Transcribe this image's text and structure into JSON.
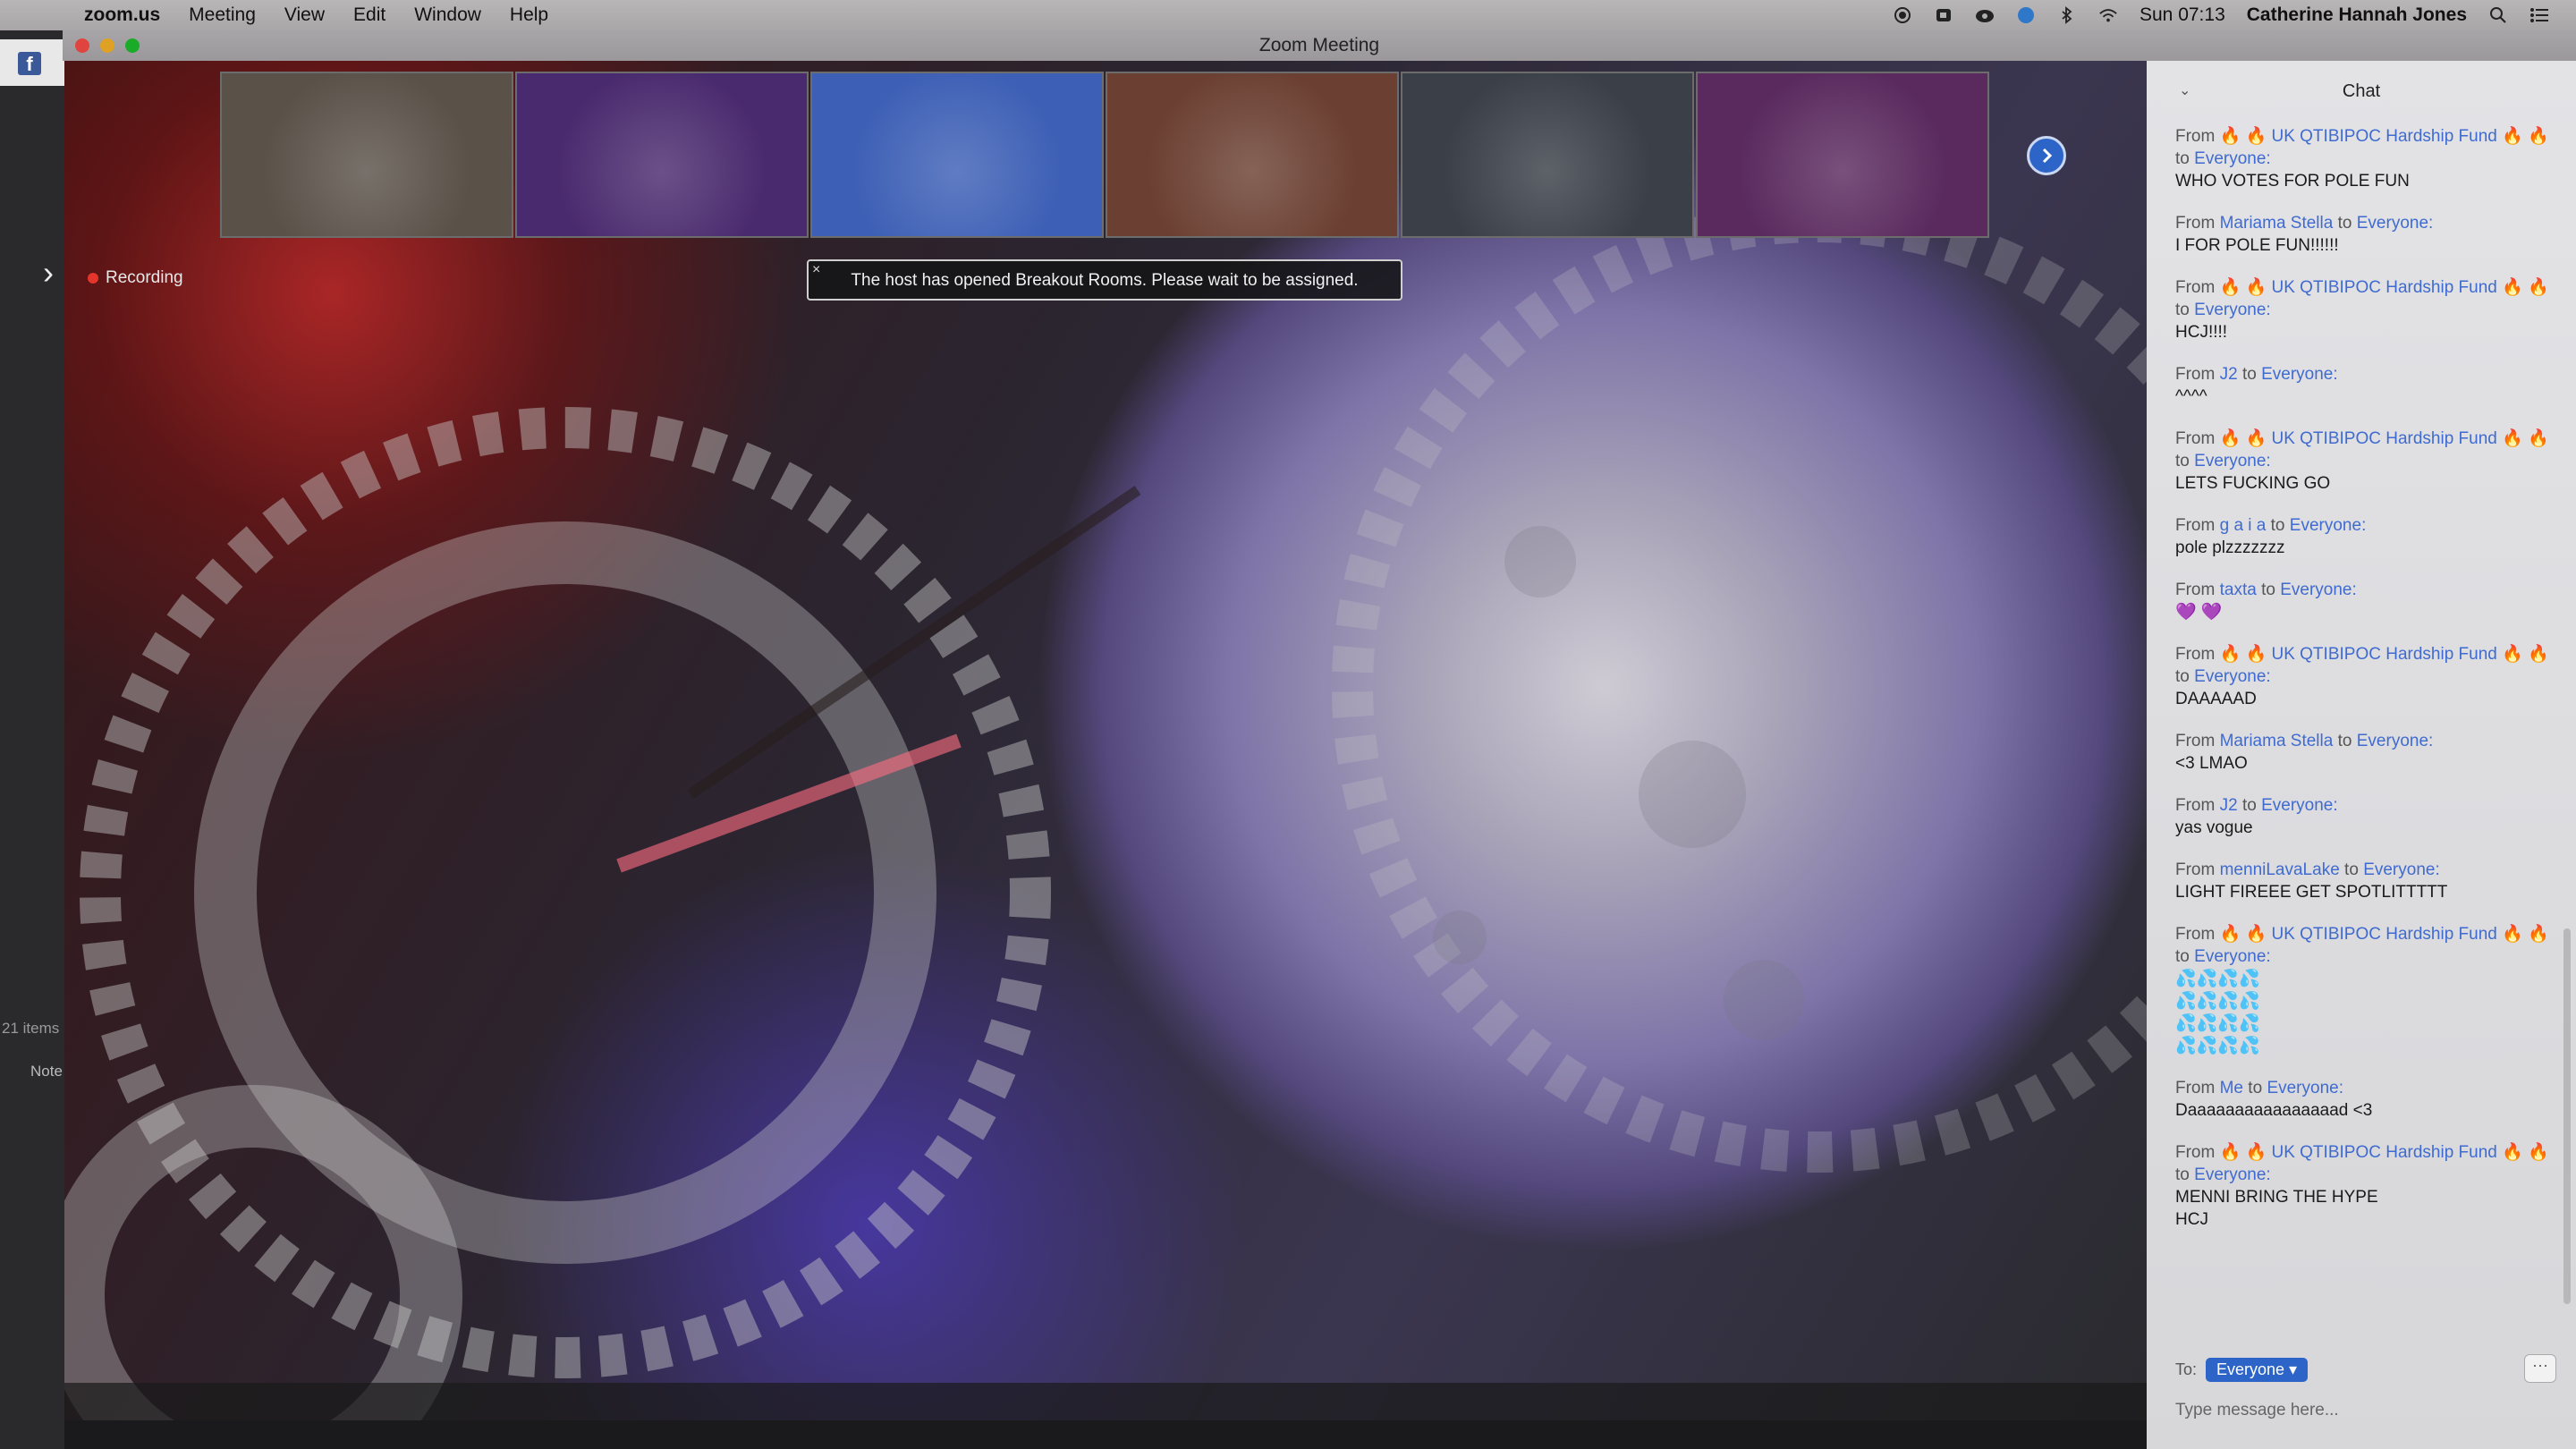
{
  "menubar": {
    "app_name": "zoom.us",
    "menus": [
      "Meeting",
      "View",
      "Edit",
      "Window",
      "Help"
    ],
    "clock": "Sun 07:13",
    "user": "Catherine Hannah Jones"
  },
  "window": {
    "title": "Zoom Meeting"
  },
  "background_app": {
    "items_count": "21 items",
    "note_label": "Note"
  },
  "video": {
    "recording_label": "Recording",
    "notice": "The host has opened Breakout Rooms. Please wait to be assigned.",
    "notice_close": "×",
    "thumbnails": [
      {
        "color": "#5a5149"
      },
      {
        "color": "#4a2a6e"
      },
      {
        "color": "#3d5fb5"
      },
      {
        "color": "#6b4032"
      },
      {
        "color": "#3a3f48"
      },
      {
        "color": "#5a2a5e"
      }
    ],
    "next_icon": "chevron-right-icon"
  },
  "chat": {
    "title": "Chat",
    "messages": [
      {
        "name": "🔥 🔥 UK QTIBIPOC Hardship Fund 🔥 🔥",
        "target": "Everyone:",
        "text": "WHO VOTES FOR POLE FUN"
      },
      {
        "name": "Mariama Stella",
        "target": "Everyone:",
        "text": "I FOR POLE FUN!!!!!!"
      },
      {
        "name": "🔥 🔥 UK QTIBIPOC Hardship Fund 🔥 🔥",
        "target": "Everyone:",
        "text": "HCJ!!!!"
      },
      {
        "name": "J2",
        "target": "Everyone:",
        "text": "^^^^"
      },
      {
        "name": "🔥 🔥 UK QTIBIPOC Hardship Fund 🔥 🔥",
        "target": "Everyone:",
        "text": "LETS FUCKING GO"
      },
      {
        "name": "g a i a",
        "target": "Everyone:",
        "text": "pole plzzzzzzz"
      },
      {
        "name": "taxta",
        "target": "Everyone:",
        "text": "💜 💜"
      },
      {
        "name": "🔥 🔥 UK QTIBIPOC Hardship Fund 🔥 🔥",
        "target": "Everyone:",
        "text": "DAAAAAD"
      },
      {
        "name": "Mariama Stella",
        "target": "Everyone:",
        "text": "<3 LMAO"
      },
      {
        "name": "J2",
        "target": "Everyone:",
        "text": "yas vogue"
      },
      {
        "name": "menniLavaLake",
        "target": "Everyone:",
        "text": "LIGHT FIREEE GET SPOTLITTTTT"
      },
      {
        "name": "🔥 🔥 UK QTIBIPOC Hardship Fund 🔥 🔥",
        "target": "Everyone:",
        "text": "💦💦💦💦\n💦💦💦💦\n💦💦💦💦\n💦💦💦💦"
      },
      {
        "name": "Me",
        "target": "Everyone:",
        "text": "Daaaaaaaaaaaaaaaad <3"
      },
      {
        "name": "🔥 🔥 UK QTIBIPOC Hardship Fund 🔥 🔥",
        "target": "Everyone:",
        "text": "MENNI BRING THE HYPE\nHCJ"
      }
    ],
    "from_label": "From",
    "to_label": "to",
    "to_field_label": "To:",
    "to_value": "Everyone ▾",
    "more_label": "···",
    "input_placeholder": "Type message here..."
  },
  "colors": {
    "accent": "#2d64c8",
    "recording": "#e3352c",
    "link": "#3f6bd0"
  }
}
